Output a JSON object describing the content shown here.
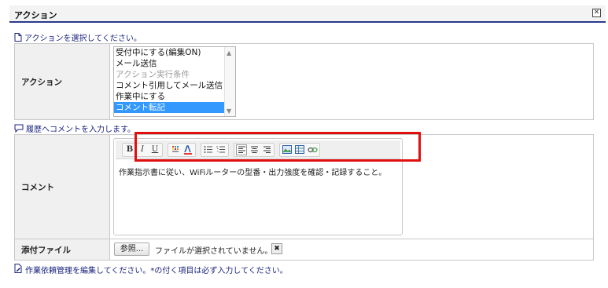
{
  "dialog": {
    "title": "アクション",
    "close_glyph": "✕"
  },
  "action_section": {
    "instruction": "アクションを選択してください。",
    "label": "アクション",
    "options": [
      {
        "text": "受付中にする(編集ON)",
        "state": "normal"
      },
      {
        "text": "メール送信",
        "state": "normal"
      },
      {
        "text": "アクション実行条件",
        "state": "disabled"
      },
      {
        "text": "コメント引用してメール送信",
        "state": "normal"
      },
      {
        "text": "作業中にする",
        "state": "normal"
      },
      {
        "text": "コメント転記",
        "state": "selected"
      }
    ]
  },
  "comment_section": {
    "instruction": "履歴へコメントを入力します。",
    "label": "コメント",
    "body": "作業指示書に従い、WiFiルーターの型番・出力強度を確認・記録すること。",
    "toolbar": {
      "bold": "B",
      "italic": "I",
      "underline": "U"
    }
  },
  "attachment": {
    "label": "添付ファイル",
    "browse_label": "参照...",
    "status": "ファイルが選択されていません。",
    "clear_glyph": "✖"
  },
  "footer": {
    "note": "作業依頼管理を編集してください。*の付く項目は必ず入力してください。"
  },
  "colors": {
    "accent": "#1a237e",
    "selected": "#3399ff",
    "highlight": "#e01010"
  }
}
